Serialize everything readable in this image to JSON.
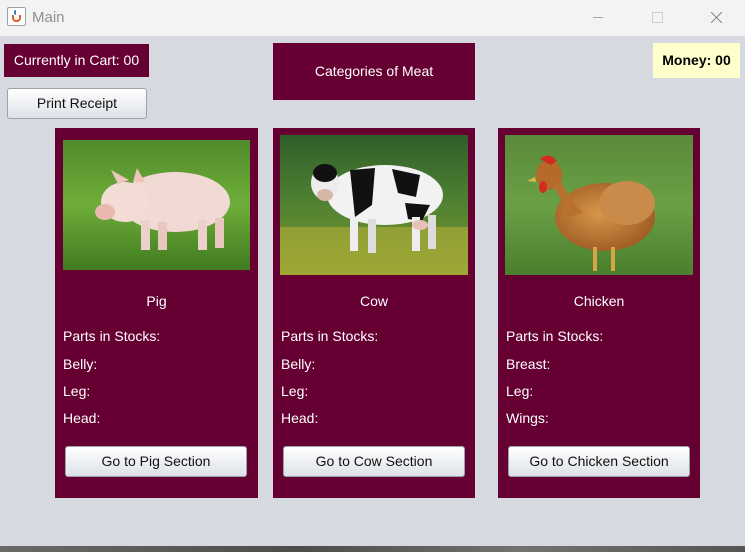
{
  "window": {
    "title": "Main",
    "app_icon": "java-cup-icon",
    "controls": [
      "minimize-icon",
      "maximize-icon",
      "close-icon"
    ]
  },
  "header": {
    "cart_label": "Currently in Cart: 00",
    "category_title": "Categories of Meat",
    "money_label": "Money: 00",
    "print_receipt_label": "Print Receipt"
  },
  "cards": [
    {
      "id": "pig",
      "image": "pig on grass",
      "name": "Pig",
      "stock_heading": "Parts in Stocks:",
      "parts": [
        "Belly:",
        "Leg:",
        "Head:"
      ],
      "button_label": "Go to Pig Section"
    },
    {
      "id": "cow",
      "image": "cow in field",
      "name": "Cow",
      "stock_heading": "Parts in Stocks:",
      "parts": [
        "Belly:",
        "Leg:",
        "Head:"
      ],
      "button_label": "Go to Cow Section"
    },
    {
      "id": "chicken",
      "image": "chicken on grass",
      "name": "Chicken",
      "stock_heading": "Parts in Stocks:",
      "parts": [
        "Breast:",
        "Leg:",
        "Wings:"
      ],
      "button_label": "Go to Chicken Section"
    }
  ],
  "colors": {
    "panel": "#660033",
    "background": "#d6d9e0",
    "money_bg": "#ffffcc"
  }
}
